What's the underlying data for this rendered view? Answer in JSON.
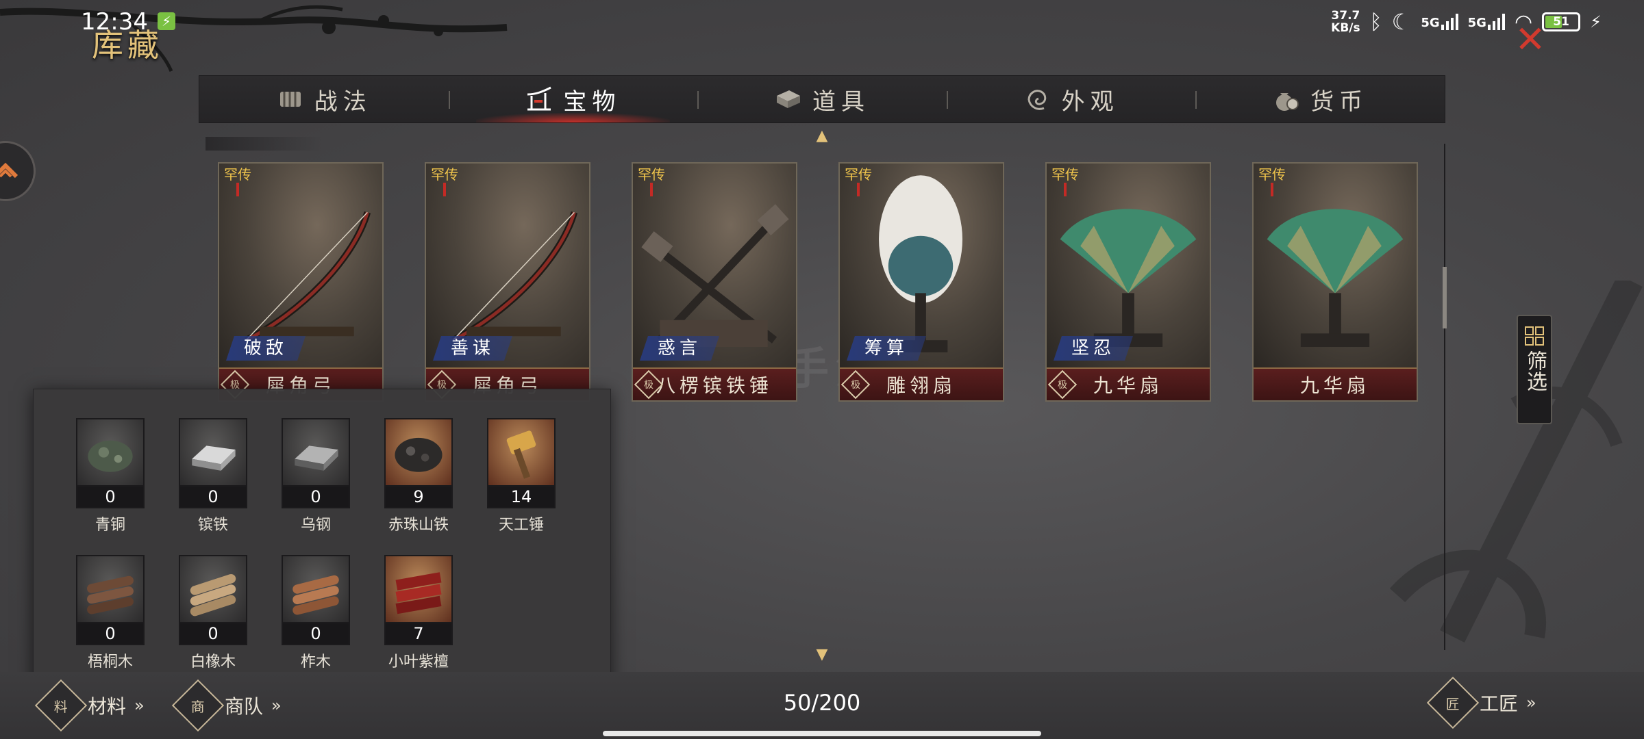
{
  "status_bar": {
    "time": "12:34",
    "net_speed_value": "37.7",
    "net_speed_unit": "KB/s",
    "signal_1": "5G",
    "signal_2": "5G",
    "battery": "51"
  },
  "page": {
    "title": "库藏",
    "capacity": "50/200"
  },
  "tabs": [
    {
      "label": "战法",
      "icon": "scroll-icon"
    },
    {
      "label": "宝物",
      "icon": "pagoda-icon",
      "active": true
    },
    {
      "label": "道具",
      "icon": "chest-icon"
    },
    {
      "label": "外观",
      "icon": "swirl-icon"
    },
    {
      "label": "货币",
      "icon": "money-bag-icon"
    }
  ],
  "treasures": [
    {
      "rarity": "罕传",
      "skill": "破敌",
      "name": "犀角弓",
      "grade": "极",
      "art": "bow"
    },
    {
      "rarity": "罕传",
      "skill": "善谋",
      "name": "犀角弓",
      "grade": "极",
      "art": "bow"
    },
    {
      "rarity": "罕传",
      "skill": "惑言",
      "name": "八楞镔铁锤",
      "grade": "极",
      "art": "hammers"
    },
    {
      "rarity": "罕传",
      "skill": "筹算",
      "name": "雕翎扇",
      "grade": "极",
      "art": "feather-fan"
    },
    {
      "rarity": "罕传",
      "skill": "坚忍",
      "name": "九华扇",
      "grade": "极",
      "art": "green-fan"
    },
    {
      "rarity": "罕传",
      "skill": "",
      "name": "九华扇",
      "grade": "",
      "art": "green-fan"
    }
  ],
  "filter": {
    "label": "筛选"
  },
  "materials": [
    {
      "name": "青铜",
      "count": "0",
      "icon": "bronze-ore-icon"
    },
    {
      "name": "镔铁",
      "count": "0",
      "icon": "iron-ingot-icon"
    },
    {
      "name": "乌钢",
      "count": "0",
      "icon": "steel-ingot-icon"
    },
    {
      "name": "赤珠山铁",
      "count": "9",
      "icon": "ore-icon"
    },
    {
      "name": "天工锤",
      "count": "14",
      "icon": "hammer-icon"
    },
    {
      "name": "梧桐木",
      "count": "0",
      "icon": "logs-icon"
    },
    {
      "name": "白橡木",
      "count": "0",
      "icon": "logs-icon"
    },
    {
      "name": "柞木",
      "count": "0",
      "icon": "logs-icon"
    },
    {
      "name": "小叶紫檀",
      "count": "7",
      "icon": "red-wood-icon"
    }
  ],
  "bottom": {
    "materials_label": "材料",
    "materials_emblem": "料",
    "caravan_label": "商队",
    "caravan_emblem": "商",
    "craftsman_label": "工匠",
    "craftsman_emblem": "匠",
    "chevrons": "»"
  },
  "colors": {
    "accent_gold": "#e3c27a",
    "active_tab_red": "#c7302a",
    "name_bar": "#5a1e1e",
    "skill_tag_blue": "#283c82",
    "close_red": "#d23a2e"
  }
}
